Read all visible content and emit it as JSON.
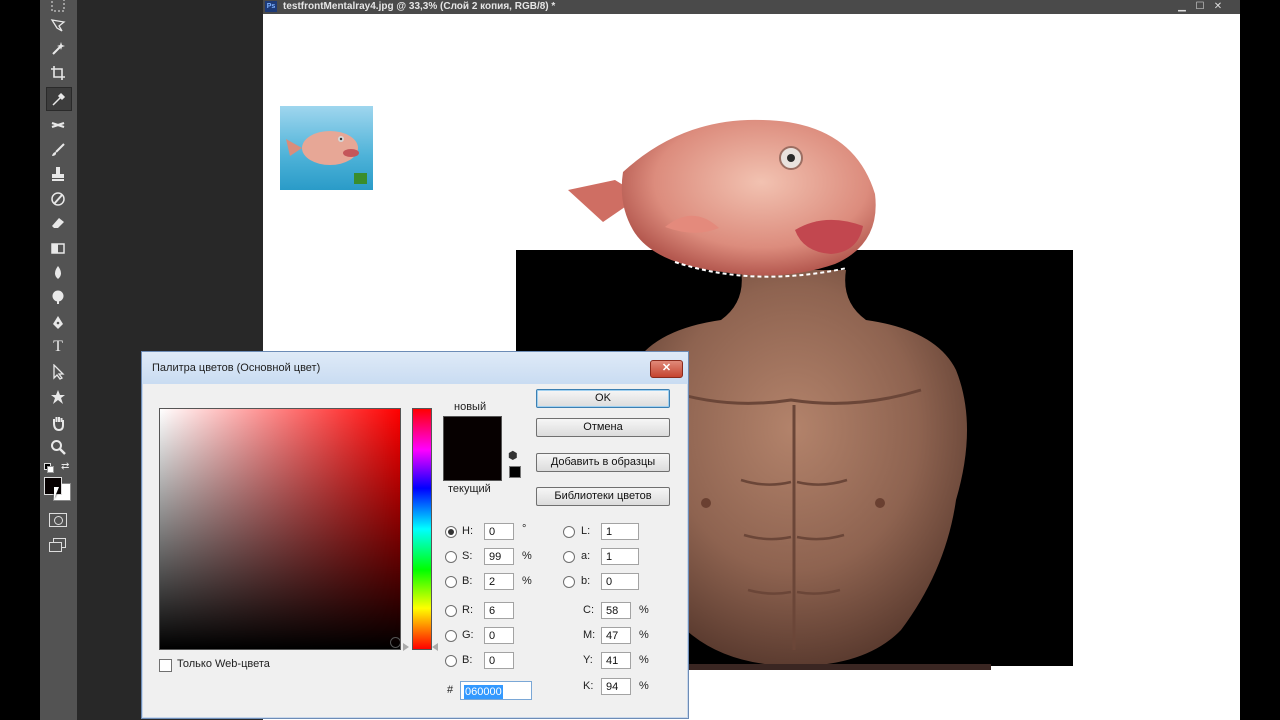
{
  "document": {
    "title": "testfrontMentalray4.jpg @ 33,3% (Слой 2 копия, RGB/8) *",
    "app_icon": "Ps"
  },
  "toolbar": {
    "tools": [
      "marquee-icon",
      "lasso-icon",
      "magic-wand-icon",
      "crop-icon",
      "eyedropper-icon",
      "healing-icon",
      "brush-icon",
      "stamp-icon",
      "history-brush-icon",
      "eraser-icon",
      "gradient-icon",
      "blur-icon",
      "dodge-icon",
      "pen-icon",
      "type-icon",
      "path-select-icon",
      "shape-icon",
      "hand-icon",
      "zoom-icon"
    ],
    "type_tool_label": "T",
    "foreground_color": "#060000",
    "background_color": "#ffffff"
  },
  "dialog": {
    "title": "Палитра цветов (Основной цвет)",
    "close_label": "✕",
    "new_label": "новый",
    "current_label": "текущий",
    "buttons": {
      "ok": "OK",
      "cancel": "Отмена",
      "add_swatches": "Добавить в образцы",
      "color_libraries": "Библиотеки цветов"
    },
    "web_only_label": "Только Web-цвета",
    "hsb": {
      "h_label": "H:",
      "h_value": "0",
      "h_unit": "°",
      "s_label": "S:",
      "s_value": "99",
      "s_unit": "%",
      "b_label": "B:",
      "b_value": "2",
      "b_unit": "%"
    },
    "rgb": {
      "r_label": "R:",
      "r_value": "6",
      "g_label": "G:",
      "g_value": "0",
      "b_label": "B:",
      "b_value": "0"
    },
    "lab": {
      "l_label": "L:",
      "l_value": "1",
      "a_label": "a:",
      "a_value": "1",
      "b_label": "b:",
      "b_value": "0"
    },
    "cmyk": {
      "c_label": "C:",
      "c_value": "58",
      "m_label": "M:",
      "m_value": "47",
      "y_label": "Y:",
      "y_value": "41",
      "k_label": "K:",
      "k_value": "94",
      "unit": "%"
    },
    "hex_label": "#",
    "hex_value": "060000",
    "new_color": "#060000",
    "current_color": "#060000"
  }
}
